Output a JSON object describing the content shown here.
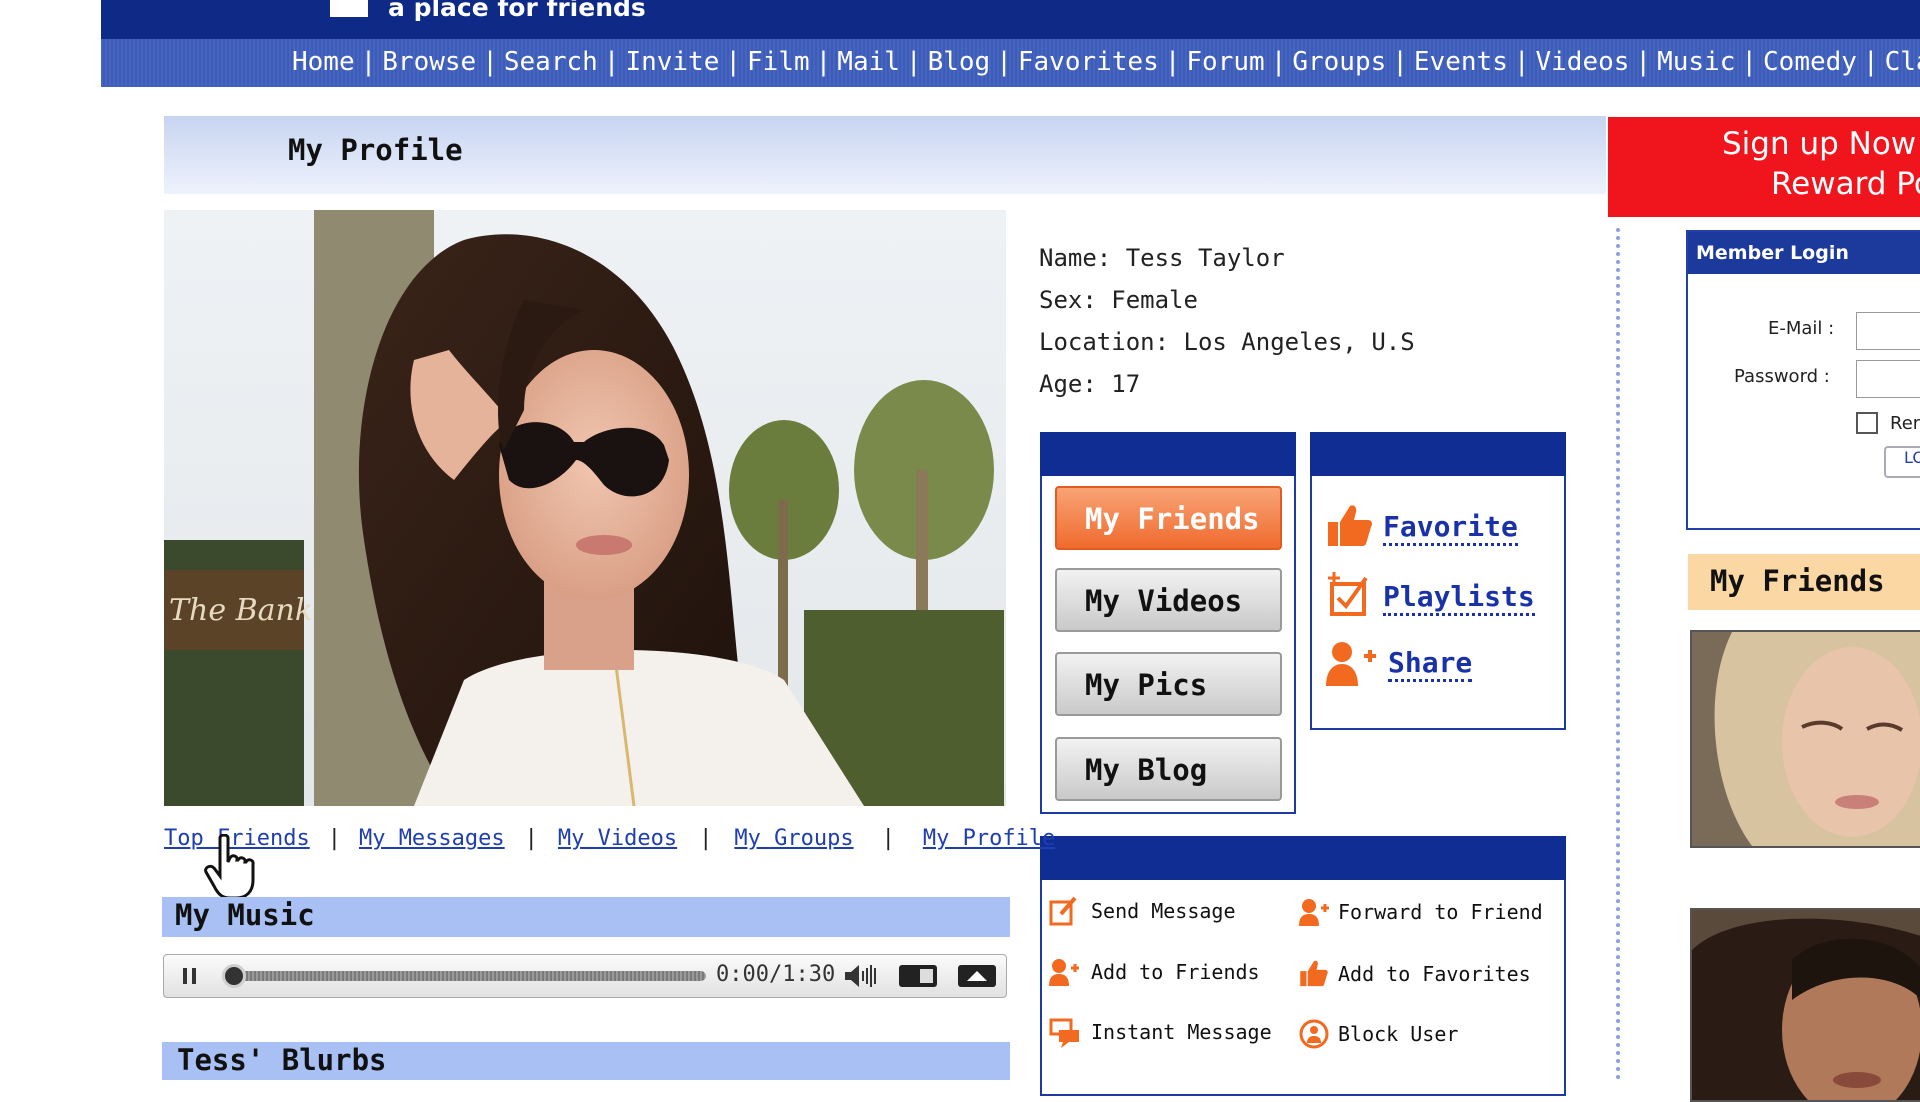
{
  "header": {
    "tagline": "a place for friends",
    "nav": [
      "Home",
      "Browse",
      "Search",
      "Invite",
      "Film",
      "Mail",
      "Blog",
      "Favorites",
      "Forum",
      "Groups",
      "Events",
      "Videos",
      "Music",
      "Comedy",
      "Clas"
    ]
  },
  "profile_header": {
    "title": "My Profile"
  },
  "signup": {
    "line1": "Sign up Now a",
    "line2": "Reward Po"
  },
  "profile": {
    "name": "Name: Tess Taylor",
    "sex": "Sex: Female",
    "location": "Location: Los Angeles, U.S",
    "age": "Age: 17",
    "photo_sign_text": "The Bank"
  },
  "profile_nav": [
    "My Friends",
    "My Videos",
    "My Pics",
    "My Blog"
  ],
  "quick_actions": {
    "favorite": "Favorite",
    "playlists": "Playlists",
    "share": "Share"
  },
  "actions": {
    "send_message": "Send Message",
    "forward_to_friend": "Forward to Friend",
    "add_to_friends": "Add to Friends",
    "add_to_favorites": "Add to Favorites",
    "instant_message": "Instant Message",
    "block_user": "Block User"
  },
  "sublinks": [
    "Top Friends",
    "My Messages",
    "My Videos",
    "My Groups",
    "My Profile"
  ],
  "music": {
    "title": "My Music",
    "time": "0:00/1:30",
    "progress": 0.0
  },
  "blurbs": {
    "title": "Tess' Blurbs"
  },
  "login": {
    "title": "Member Login",
    "email_label": "E-Mail :",
    "password_label": "Password :",
    "remember_label": "Rer",
    "button_label": "LO"
  },
  "right_friends": {
    "title": "My Friends"
  },
  "colors": {
    "header_navy": "#0e2a86",
    "accent_orange": "#f06b2e",
    "link_blue": "#1f3fb0",
    "signup_red": "#f0141d"
  }
}
